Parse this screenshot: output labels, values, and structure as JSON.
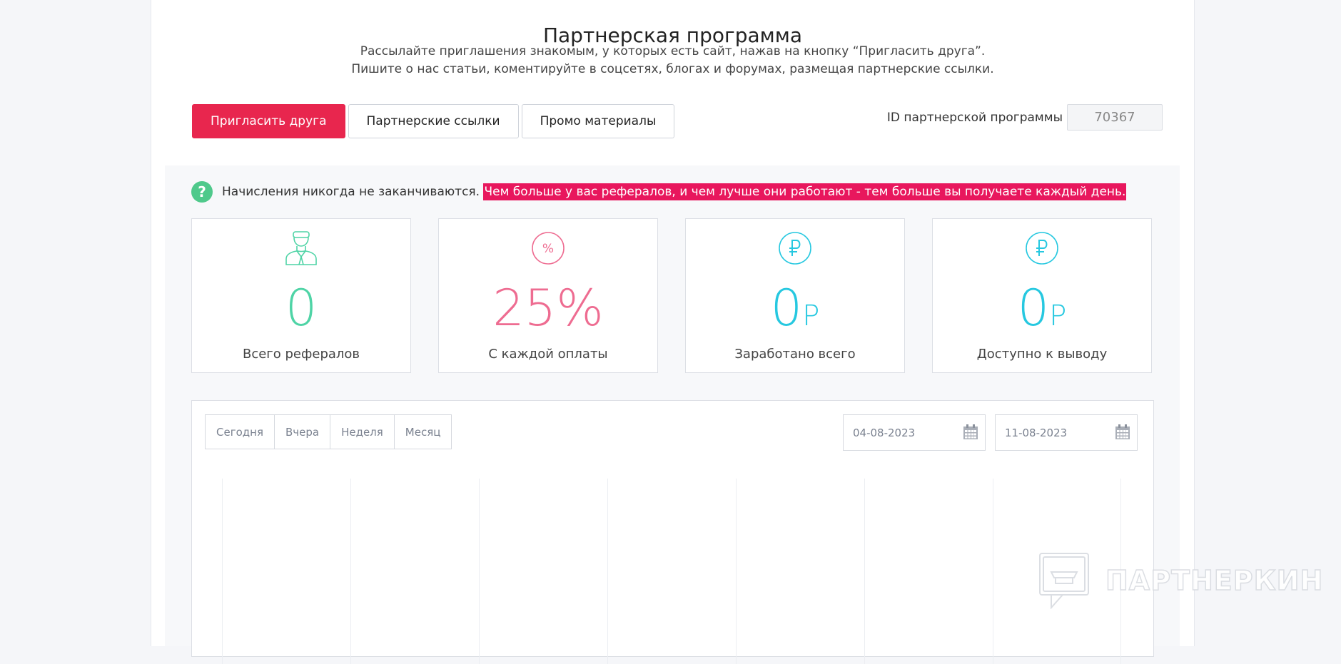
{
  "header": {
    "title": "Партнерская программа",
    "subtitle_line1": "Рассылайте приглашения знакомым, у которых есть сайт, нажав на кнопку “Пригласить друга”.",
    "subtitle_line2": "Пишите о нас статьи, коментируйте в соцсетях, блогах и форумах, размещая партнерские ссылки."
  },
  "tabs": [
    {
      "label": "Пригласить друга",
      "active": true
    },
    {
      "label": "Партнерские ссылки",
      "active": false
    },
    {
      "label": "Промо материалы",
      "active": false
    }
  ],
  "partner_id": {
    "label": "ID партнерской программы",
    "value": "70367"
  },
  "note": {
    "text": "Начисления никогда не заканчиваются.",
    "highlight": "Чем больше у вас рефералов, и чем лучше они работают - тем больше вы получаете каждый день."
  },
  "stats": [
    {
      "icon": "user-icon",
      "value": "0",
      "unit": "",
      "label": "Всего рефералов",
      "color": "#4fd4a6"
    },
    {
      "icon": "percent-icon",
      "value": "25%",
      "unit": "",
      "label": "С каждой оплаты",
      "color": "#ee6c91"
    },
    {
      "icon": "ruble-icon",
      "value": "0",
      "unit": "Р",
      "label": "Заработано всего",
      "color": "#26c8e0"
    },
    {
      "icon": "ruble-icon",
      "value": "0",
      "unit": "Р",
      "label": "Доступно к выводу",
      "color": "#26c8e0"
    }
  ],
  "filters": {
    "periods": [
      "Сегодня",
      "Вчера",
      "Неделя",
      "Месяц"
    ],
    "date_from": "04-08-2023",
    "date_to": "11-08-2023"
  },
  "watermark": "ПАРТНЕРКИН",
  "colors": {
    "accent": "#e8264e",
    "highlight": "#e8175d",
    "success": "#4fc98b"
  }
}
